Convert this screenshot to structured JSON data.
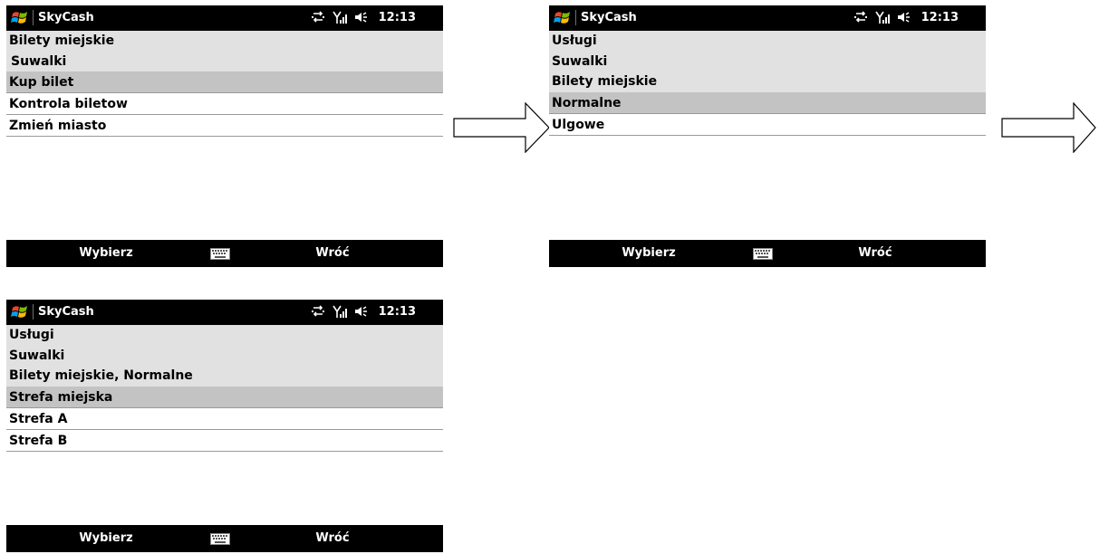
{
  "app_title": "SkyCash",
  "clock": "12:13",
  "softkeys": {
    "left": "Wybierz",
    "right": "Wróć"
  },
  "screens": [
    {
      "header": [
        "Bilety miejskie",
        "Suwalki"
      ],
      "selected": "Kup bilet",
      "items": [
        "Kontrola biletow",
        "Zmień miasto"
      ]
    },
    {
      "header": [
        "Usługi",
        "Suwalki",
        "Bilety miejskie"
      ],
      "selected": "Normalne",
      "items": [
        "Ulgowe"
      ]
    },
    {
      "header": [
        "Usługi",
        "Suwalki",
        "Bilety miejskie, Normalne"
      ],
      "selected": "Strefa miejska",
      "items": [
        "Strefa A",
        "Strefa B"
      ]
    }
  ],
  "icons": {
    "start": "windows-flag-icon",
    "connectivity": "sync-arrows-icon",
    "signal": "signal-strength-icon",
    "volume": "speaker-icon",
    "keyboard": "keyboard-icon",
    "flow": "right-arrow-icon"
  },
  "colors": {
    "bar": "#000000",
    "header_bg": "#e1e1e1",
    "selected_bg": "#c3c3c3"
  }
}
